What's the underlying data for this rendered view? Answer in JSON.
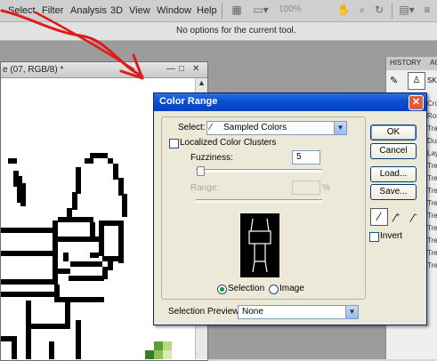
{
  "menu": {
    "items": [
      "Select",
      "Filter",
      "Analysis",
      "3D",
      "View",
      "Window",
      "Help"
    ],
    "zoom": "100%"
  },
  "options_bar": {
    "text": "No options for the current tool."
  },
  "document": {
    "title": "e (07, RGB/8) *"
  },
  "history_panel": {
    "tabs": [
      "HISTORY",
      "AC"
    ],
    "snapshot_label": "SKE",
    "rows": [
      "Crop",
      "Rotat",
      "Trans",
      "Dupli",
      "Laye",
      "Trend",
      "Trend",
      "Trend",
      "Trend",
      "Trend",
      "Trend",
      "Trend",
      "Trend",
      "Trend"
    ]
  },
  "dialog": {
    "title": "Color Range",
    "select_label": "Select:",
    "select_value": "Sampled Colors",
    "localized_label": "Localized Color Clusters",
    "fuzziness_label": "Fuzziness:",
    "fuzziness_value": "5",
    "range_label": "Range:",
    "range_unit": "%",
    "fuzziness_fraction": 0.025,
    "radio_selection": "Selection",
    "radio_image": "Image",
    "preview_label": "Selection Preview:",
    "preview_value": "None",
    "buttons": {
      "ok": "OK",
      "cancel": "Cancel",
      "load": "Load...",
      "save": "Save..."
    },
    "invert_label": "Invert"
  },
  "colors": {
    "titlebar": "#0a4fd1",
    "annotation": "#e01919",
    "dialog_bg": "#ece9d8"
  }
}
